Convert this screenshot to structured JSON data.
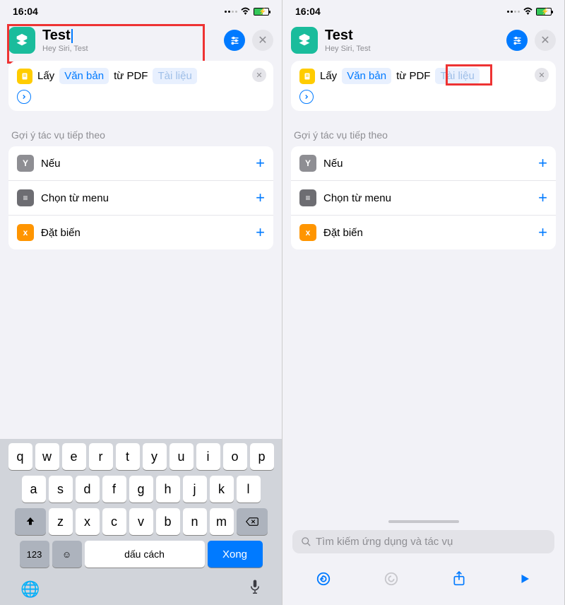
{
  "status": {
    "time": "16:04"
  },
  "header": {
    "title": "Test",
    "subtitle": "Hey Siri, Test"
  },
  "action": {
    "prefix": "Lấy",
    "token1": "Văn bản",
    "mid": "từ PDF",
    "token2": "Tài liệu"
  },
  "suggestions": {
    "label": "Gợi ý tác vụ tiếp theo",
    "items": [
      {
        "label": "Nếu",
        "iconText": "Y"
      },
      {
        "label": "Chọn từ menu",
        "iconText": "≡"
      },
      {
        "label": "Đặt biến",
        "iconText": "x"
      }
    ]
  },
  "keyboard": {
    "row1": [
      "q",
      "w",
      "e",
      "r",
      "t",
      "y",
      "u",
      "i",
      "o",
      "p"
    ],
    "row2": [
      "a",
      "s",
      "d",
      "f",
      "g",
      "h",
      "j",
      "k",
      "l"
    ],
    "row3": [
      "z",
      "x",
      "c",
      "v",
      "b",
      "n",
      "m"
    ],
    "numKey": "123",
    "space": "dấu cách",
    "done": "Xong"
  },
  "search": {
    "placeholder": "Tìm kiếm ứng dụng và tác vụ"
  }
}
